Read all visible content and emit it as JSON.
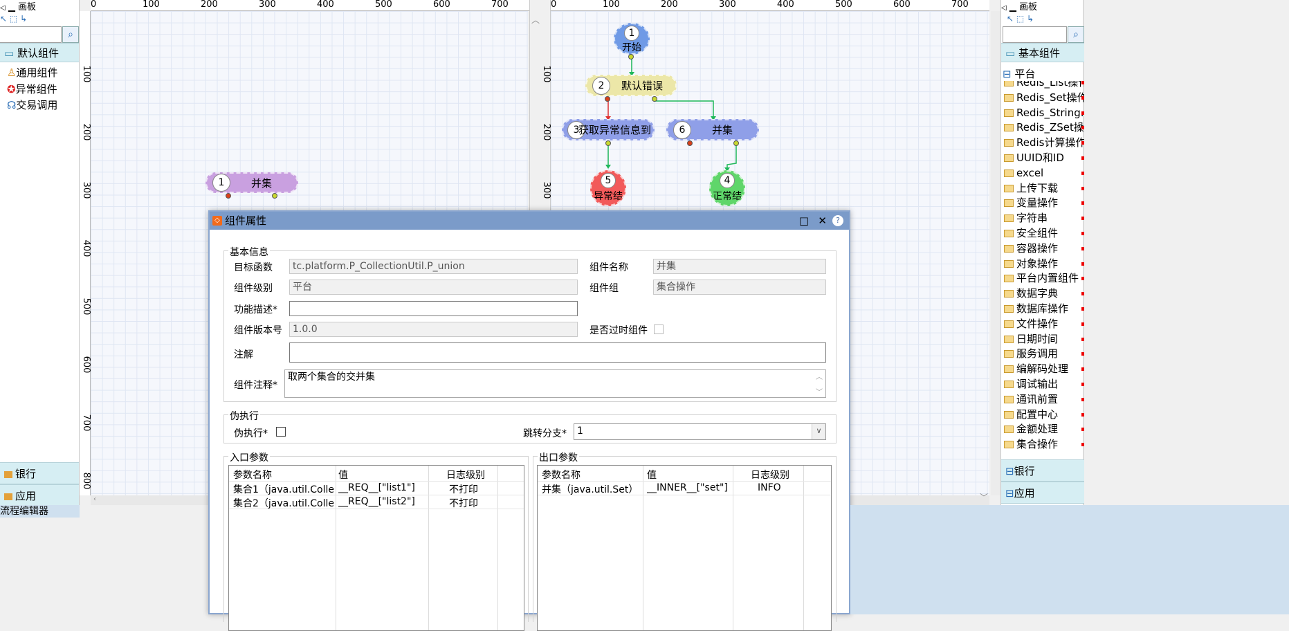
{
  "left_palette": {
    "title": "画板",
    "root": "默认组件",
    "items": [
      {
        "label": "通用组件",
        "icon": "component-icon"
      },
      {
        "label": "异常组件",
        "icon": "error-icon"
      },
      {
        "label": "交易调用",
        "icon": "call-icon"
      }
    ],
    "drawers": [
      "银行",
      "应用"
    ]
  },
  "bottom_tab": "流程编辑器",
  "ruler_left": {
    "h_ticks": [
      "0",
      "100",
      "200",
      "300",
      "400",
      "500",
      "600",
      "700"
    ],
    "v_ticks": [
      "100",
      "200",
      "300",
      "400",
      "500",
      "600",
      "700",
      "800"
    ]
  },
  "ruler_right": {
    "h_ticks": [
      "0",
      "100",
      "200",
      "300",
      "400",
      "500",
      "600",
      "700"
    ],
    "v_ticks": [
      "100",
      "200",
      "300"
    ]
  },
  "left_canvas_nodes": [
    {
      "num": "1",
      "label": "并集"
    }
  ],
  "right_canvas_nodes": [
    {
      "num": "1",
      "label": "开始"
    },
    {
      "num": "2",
      "label": "默认错误"
    },
    {
      "num": "3",
      "label": "获取异常信息到"
    },
    {
      "num": "6",
      "label": "并集"
    },
    {
      "num": "5",
      "label": "异常结"
    },
    {
      "num": "4",
      "label": "正常结"
    }
  ],
  "right_palette": {
    "title": "画板",
    "drawer_basic": "基本组件",
    "section": "平台",
    "items": [
      "Redis_List操作",
      "Redis_Set操作",
      "Redis_String...",
      "Redis_ZSet操...",
      "Redis计算操作",
      "UUID和ID",
      "excel",
      "上传下载",
      "变量操作",
      "字符串",
      "安全组件",
      "容器操作",
      "对象操作",
      "平台内置组件",
      "数据字典",
      "数据库操作",
      "文件操作",
      "日期时间",
      "服务调用",
      "编解码处理",
      "调试输出",
      "通讯前置",
      "配置中心",
      "金额处理",
      "集合操作"
    ],
    "drawers": [
      "银行",
      "应用"
    ]
  },
  "dialog": {
    "title": "组件属性",
    "basic": {
      "legend": "基本信息",
      "target_func_label": "目标函数",
      "target_func_value": "tc.platform.P_CollectionUtil.P_union",
      "comp_name_label": "组件名称",
      "comp_name_value": "并集",
      "comp_level_label": "组件级别",
      "comp_level_value": "平台",
      "comp_group_label": "组件组",
      "comp_group_value": "集合操作",
      "desc_label": "功能描述*",
      "desc_value": "",
      "version_label": "组件版本号",
      "version_value": "1.0.0",
      "deprecated_label": "是否过时组件",
      "note_label": "注解",
      "note_value": "",
      "comment_label": "组件注释*",
      "comment_value": "取两个集合的交并集"
    },
    "pseudo": {
      "legend": "伪执行",
      "exec_label": "伪执行*",
      "branch_label": "跳转分支*",
      "branch_value": "1"
    },
    "input": {
      "legend": "入口参数",
      "headers": [
        "参数名称",
        "值",
        "日志级别"
      ],
      "rows": [
        [
          "集合1（java.util.Colle...",
          "__REQ__[\"list1\"]",
          "不打印"
        ],
        [
          "集合2（java.util.Colle...",
          "__REQ__[\"list2\"]",
          "不打印"
        ]
      ]
    },
    "output": {
      "legend": "出口参数",
      "headers": [
        "参数名称",
        "值",
        "日志级别"
      ],
      "rows": [
        [
          "并集（java.util.Set）",
          "__INNER__[\"set\"]",
          "INFO"
        ]
      ]
    }
  },
  "colors": {
    "start_node": "#6f9ae6",
    "error_default": "#ece7a8",
    "process_node": "#8f9fe8",
    "union_left": "#c9a0e0",
    "end_error": "#f25a5a",
    "end_ok": "#5fd66a",
    "dialog_title": "#7b9bc9",
    "drawer": "#d6eef3"
  }
}
